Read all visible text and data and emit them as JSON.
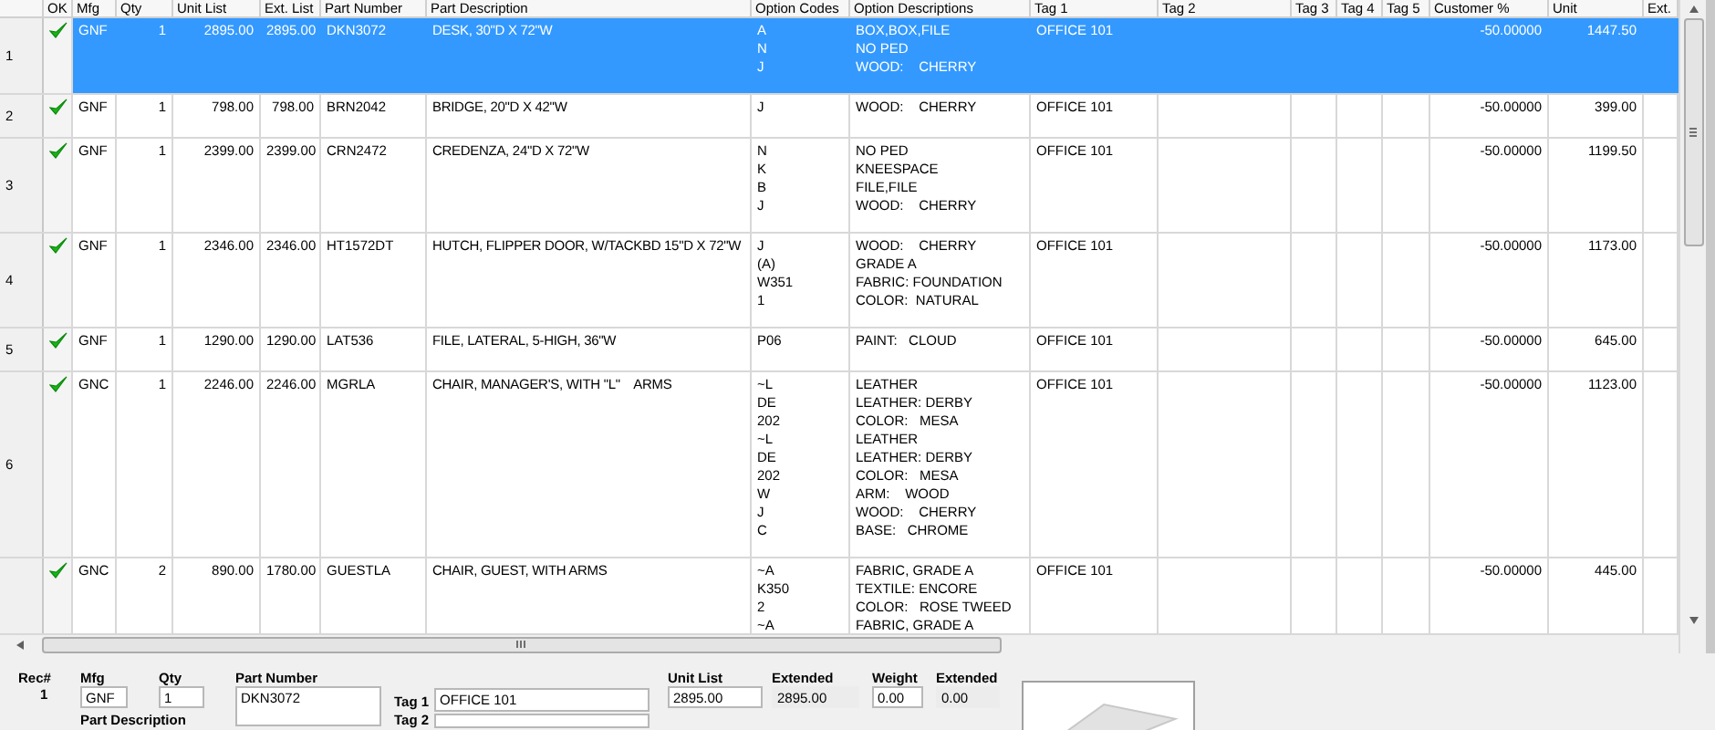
{
  "columns": [
    "OK",
    "Mfg",
    "Qty",
    "Unit List",
    "Ext. List",
    "Part Number",
    "Part Description",
    "Option Codes",
    "Option Descriptions",
    "Tag 1",
    "Tag 2",
    "Tag 3",
    "Tag 4",
    "Tag 5",
    "Customer %",
    "Unit",
    "Ext."
  ],
  "rows": [
    {
      "num": "1",
      "selected": true,
      "ok": true,
      "mfg": "GNF",
      "qty": "1",
      "unit_list": "2895.00",
      "ext_list": "2895.00",
      "part_number": "DKN3072",
      "description": "DESK, 30\"D X 72\"W",
      "option_codes": [
        "A",
        "N",
        "J"
      ],
      "option_descriptions": [
        "BOX,BOX,FILE",
        "NO PED",
        "WOOD:    CHERRY"
      ],
      "tag_1": "OFFICE 101",
      "customer_pct": "-50.00000",
      "unit": "1447.50"
    },
    {
      "num": "2",
      "selected": false,
      "ok": true,
      "mfg": "GNF",
      "qty": "1",
      "unit_list": "798.00",
      "ext_list": "798.00",
      "part_number": "BRN2042",
      "description": "BRIDGE, 20\"D X 42\"W",
      "option_codes": [
        "J"
      ],
      "option_descriptions": [
        "WOOD:    CHERRY"
      ],
      "tag_1": "OFFICE 101",
      "customer_pct": "-50.00000",
      "unit": "399.00"
    },
    {
      "num": "3",
      "selected": false,
      "ok": true,
      "mfg": "GNF",
      "qty": "1",
      "unit_list": "2399.00",
      "ext_list": "2399.00",
      "part_number": "CRN2472",
      "description": "CREDENZA, 24\"D X 72\"W",
      "option_codes": [
        "N",
        "K",
        "B",
        "J"
      ],
      "option_descriptions": [
        "NO PED",
        "KNEESPACE",
        "FILE,FILE",
        "WOOD:    CHERRY"
      ],
      "tag_1": "OFFICE 101",
      "customer_pct": "-50.00000",
      "unit": "1199.50"
    },
    {
      "num": "4",
      "selected": false,
      "ok": true,
      "mfg": "GNF",
      "qty": "1",
      "unit_list": "2346.00",
      "ext_list": "2346.00",
      "part_number": "HT1572DT",
      "description": "HUTCH, FLIPPER DOOR, W/TACKBD 15\"D X 72\"W",
      "option_codes": [
        "J",
        "(A)",
        "W351",
        "1"
      ],
      "option_descriptions": [
        "WOOD:    CHERRY",
        "GRADE A",
        "FABRIC: FOUNDATION",
        "COLOR:  NATURAL"
      ],
      "tag_1": "OFFICE 101",
      "customer_pct": "-50.00000",
      "unit": "1173.00"
    },
    {
      "num": "5",
      "selected": false,
      "ok": true,
      "mfg": "GNF",
      "qty": "1",
      "unit_list": "1290.00",
      "ext_list": "1290.00",
      "part_number": "LAT536",
      "description": "FILE, LATERAL, 5-HIGH, 36\"W",
      "option_codes": [
        "P06"
      ],
      "option_descriptions": [
        "PAINT:   CLOUD"
      ],
      "tag_1": "OFFICE 101",
      "customer_pct": "-50.00000",
      "unit": "645.00"
    },
    {
      "num": "6",
      "selected": false,
      "ok": true,
      "mfg": "GNC",
      "qty": "1",
      "unit_list": "2246.00",
      "ext_list": "2246.00",
      "part_number": "MGRLA",
      "description": "CHAIR, MANAGER'S, WITH \"L\"    ARMS",
      "option_codes": [
        "~L",
        "DE",
        "202",
        "~L",
        "DE",
        "202",
        "W",
        "J",
        "C"
      ],
      "option_descriptions": [
        "LEATHER",
        "LEATHER: DERBY",
        "COLOR:   MESA",
        "LEATHER",
        "LEATHER: DERBY",
        "COLOR:   MESA",
        "ARM:    WOOD",
        "WOOD:    CHERRY",
        "BASE:   CHROME"
      ],
      "tag_1": "OFFICE 101",
      "customer_pct": "-50.00000",
      "unit": "1123.00"
    },
    {
      "selected": false,
      "ok": true,
      "mfg": "GNC",
      "qty": "2",
      "unit_list": "890.00",
      "ext_list": "1780.00",
      "part_number": "GUESTLA",
      "description": "CHAIR, GUEST, WITH ARMS",
      "option_codes": [
        "~A",
        "K350",
        "2",
        "~A"
      ],
      "option_descriptions": [
        "FABRIC, GRADE A",
        "TEXTILE: ENCORE",
        "COLOR:   ROSE TWEED",
        "FABRIC, GRADE A"
      ],
      "tag_1": "OFFICE 101",
      "customer_pct": "-50.00000",
      "unit": "445.00"
    }
  ],
  "detail": {
    "rec": {
      "label": "Rec#",
      "value": "1"
    },
    "mfg": {
      "label": "Mfg",
      "value": "GNF"
    },
    "qty": {
      "label": "Qty",
      "value": "1"
    },
    "part_number": {
      "label": "Part Number",
      "value": "DKN3072"
    },
    "part_description": {
      "label": "Part Description"
    },
    "tag_1": {
      "label": "Tag 1",
      "value": "OFFICE 101"
    },
    "tag_2": {
      "label": "Tag 2"
    },
    "unit_list": {
      "label": "Unit List",
      "value": "2895.00",
      "disabled": false
    },
    "extended": {
      "label": "Extended",
      "value": "2895.00",
      "disabled": true
    },
    "weight": {
      "label": "Weight",
      "value": "0.00",
      "disabled": false
    },
    "extended_weight": {
      "label": "Extended",
      "value": "0.00",
      "disabled": true
    }
  }
}
